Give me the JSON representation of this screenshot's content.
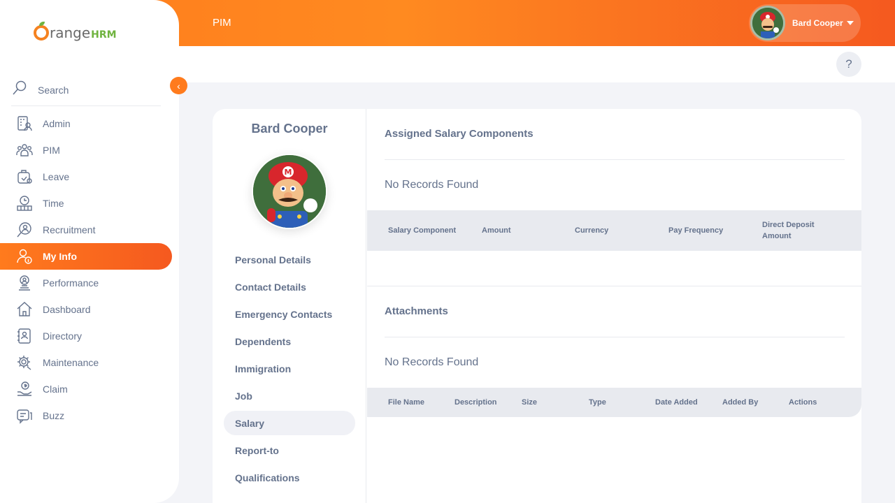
{
  "topbar": {
    "title": "PIM",
    "user_name": "Bard Cooper"
  },
  "help": {
    "label": "?"
  },
  "logo": {
    "text_o": "",
    "text_range": "range",
    "text_hrm": "HRM"
  },
  "sidebar": {
    "search_label": "Search",
    "items": [
      {
        "label": "Admin",
        "icon": "admin-icon"
      },
      {
        "label": "PIM",
        "icon": "pim-icon"
      },
      {
        "label": "Leave",
        "icon": "leave-icon"
      },
      {
        "label": "Time",
        "icon": "time-icon"
      },
      {
        "label": "Recruitment",
        "icon": "recruitment-icon"
      },
      {
        "label": "My Info",
        "icon": "my-info-icon",
        "active": true
      },
      {
        "label": "Performance",
        "icon": "performance-icon"
      },
      {
        "label": "Dashboard",
        "icon": "dashboard-icon"
      },
      {
        "label": "Directory",
        "icon": "directory-icon"
      },
      {
        "label": "Maintenance",
        "icon": "maintenance-icon"
      },
      {
        "label": "Claim",
        "icon": "claim-icon"
      },
      {
        "label": "Buzz",
        "icon": "buzz-icon"
      }
    ]
  },
  "employee": {
    "name": "Bard Cooper",
    "tabs": [
      {
        "label": "Personal Details"
      },
      {
        "label": "Contact Details"
      },
      {
        "label": "Emergency Contacts"
      },
      {
        "label": "Dependents"
      },
      {
        "label": "Immigration"
      },
      {
        "label": "Job"
      },
      {
        "label": "Salary",
        "active": true
      },
      {
        "label": "Report-to"
      },
      {
        "label": "Qualifications"
      }
    ]
  },
  "salary": {
    "title": "Assigned Salary Components",
    "empty": "No Records Found",
    "columns": [
      "Salary Component",
      "Amount",
      "Currency",
      "Pay Frequency",
      "Direct Deposit Amount"
    ]
  },
  "attachments": {
    "title": "Attachments",
    "empty": "No Records Found",
    "columns": [
      "File Name",
      "Description",
      "Size",
      "Type",
      "Date Added",
      "Added By",
      "Actions"
    ]
  },
  "colors": {
    "accent": "#ff7b1d",
    "accent_dark": "#f5591f",
    "text": "#64728c",
    "bg": "#f3f4f8"
  }
}
